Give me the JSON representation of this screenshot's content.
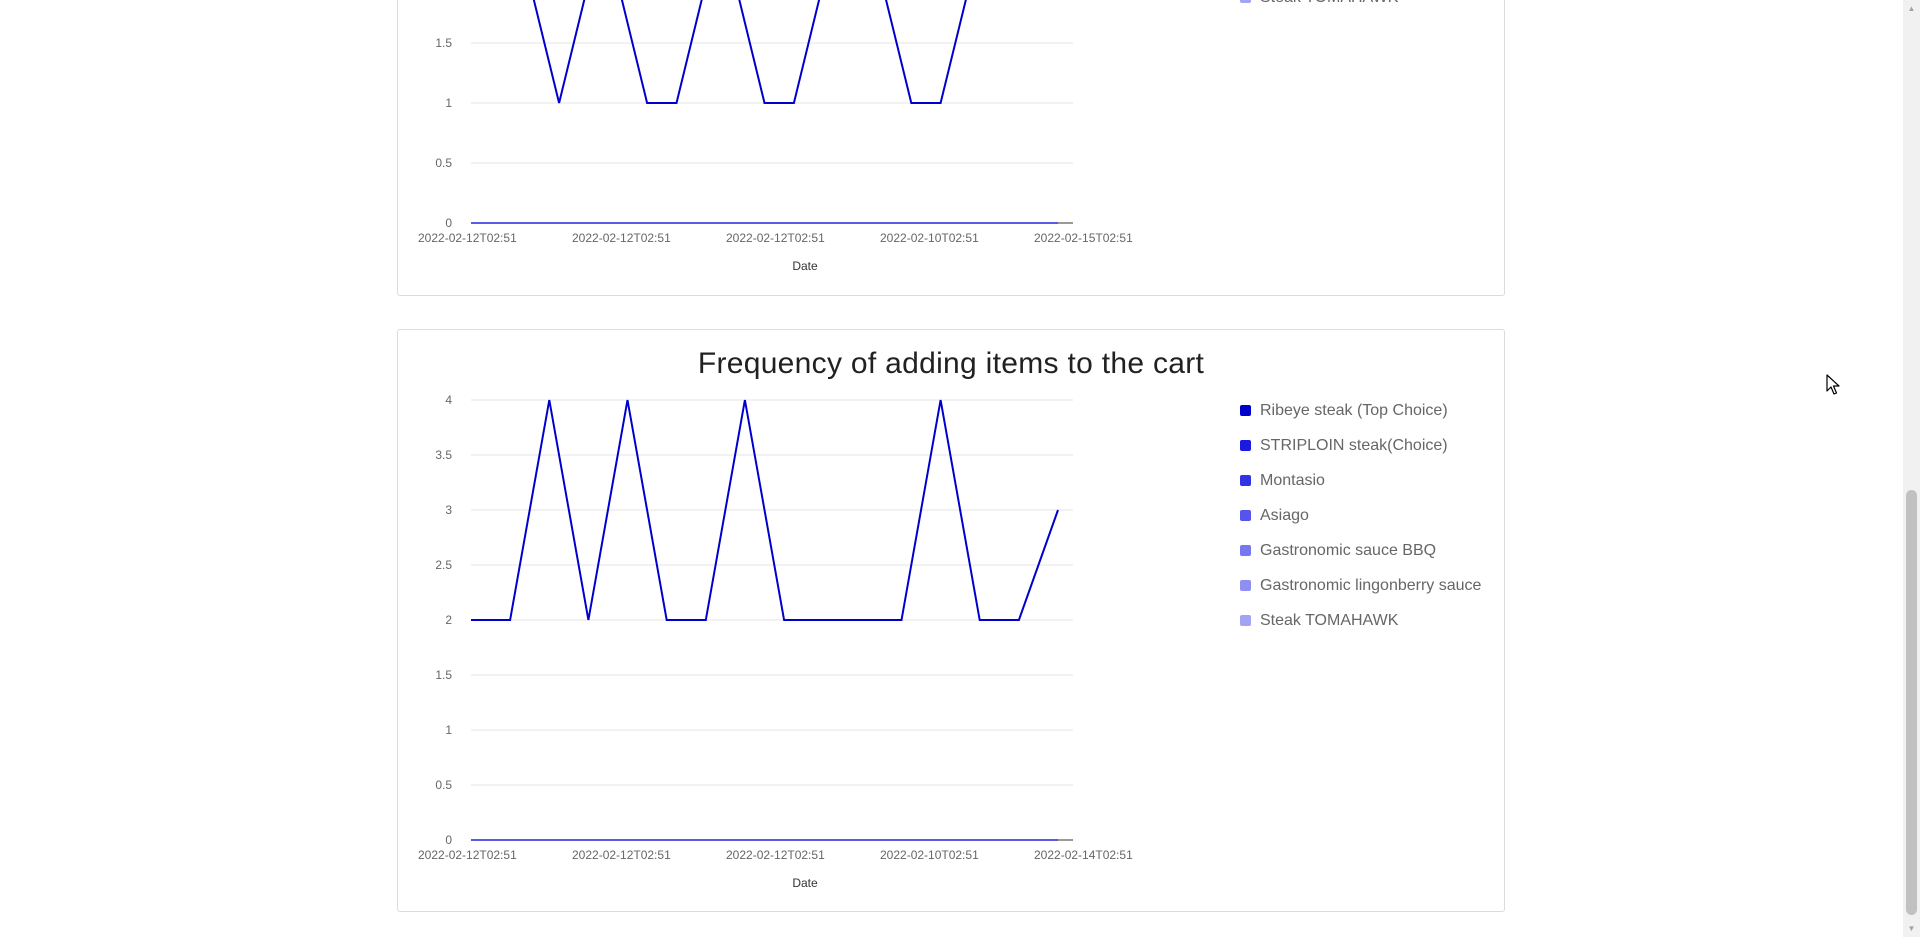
{
  "colors": {
    "series": [
      "#0000cc",
      "#1a1ae0",
      "#3333e6",
      "#5555ec",
      "#7777f0",
      "#8f8ff3",
      "#a3a3f5"
    ]
  },
  "scrollbar": {
    "up_icon": "scroll-up-arrow-icon",
    "down_icon": "scroll-down-arrow-icon"
  },
  "chart_data": [
    {
      "type": "line",
      "title": "",
      "xlabel": "Date",
      "ylabel": "",
      "ylim": [
        0,
        2
      ],
      "visible_y_ticks": [
        "0",
        "0.5",
        "1",
        "1.5"
      ],
      "y_tick_values": [
        0,
        0.5,
        1,
        1.5
      ],
      "x_tick_labels": [
        "2022-02-12T02:51",
        "2022-02-12T02:51",
        "2022-02-12T02:51",
        "2022-02-10T02:51",
        "2022-02-15T02:51"
      ],
      "grid": true,
      "legend_position": "right",
      "series": [
        {
          "name": "Steak TOMAHAWK",
          "values": [
            2,
            2,
            2,
            1,
            2,
            2,
            1,
            1,
            2,
            2,
            1,
            1,
            2,
            2,
            2,
            1,
            1,
            2,
            2,
            2,
            2
          ]
        },
        {
          "values": [
            0,
            0,
            0,
            0,
            0,
            0,
            0,
            0,
            0,
            0,
            0,
            0,
            0,
            0,
            0,
            0,
            0,
            0,
            0,
            0,
            0
          ]
        }
      ]
    },
    {
      "type": "line",
      "title": "Frequency of adding items to the cart",
      "xlabel": "Date",
      "ylabel": "",
      "ylim": [
        0,
        4
      ],
      "y_tick_labels": [
        "0",
        "0.5",
        "1",
        "1.5",
        "2",
        "2.5",
        "3",
        "3.5",
        "4"
      ],
      "y_tick_values": [
        0,
        0.5,
        1,
        1.5,
        2,
        2.5,
        3,
        3.5,
        4
      ],
      "x_tick_labels": [
        "2022-02-12T02:51",
        "2022-02-12T02:51",
        "2022-02-12T02:51",
        "2022-02-10T02:51",
        "2022-02-14T02:51"
      ],
      "grid": true,
      "legend_position": "right",
      "legend": [
        "Ribeye steak (Top Choice)",
        "STRIPLOIN steak(Choice)",
        "Montasio",
        "Asiago",
        "Gastronomic sauce BBQ",
        "Gastronomic lingonberry sauce",
        "Steak TOMAHAWK"
      ],
      "series": [
        {
          "name": "Ribeye steak (Top Choice)",
          "values": [
            2,
            2,
            4,
            2,
            4,
            2,
            2,
            4,
            2,
            2,
            2,
            2,
            4,
            2,
            2,
            3
          ]
        },
        {
          "values": [
            0,
            0,
            0,
            0,
            0,
            0,
            0,
            0,
            0,
            0,
            0,
            0,
            0,
            0,
            0,
            0
          ]
        }
      ]
    }
  ]
}
